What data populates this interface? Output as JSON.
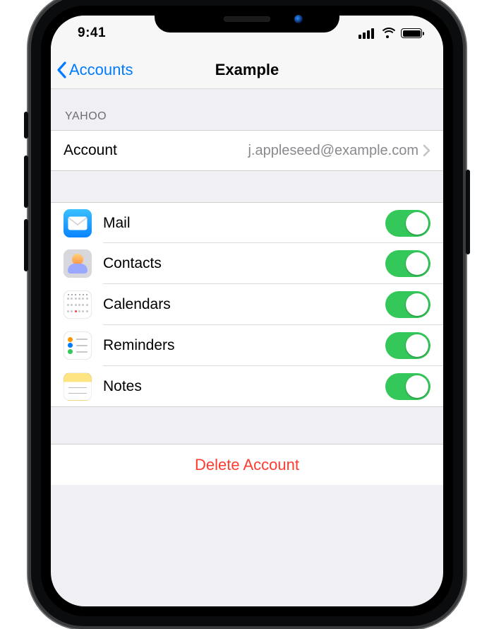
{
  "status": {
    "time": "9:41"
  },
  "nav": {
    "back_label": "Accounts",
    "title": "Example"
  },
  "section_header": "YAHOO",
  "account_row": {
    "label": "Account",
    "value": "j.appleseed@example.com"
  },
  "toggles": [
    {
      "id": "mail",
      "label": "Mail",
      "on": true
    },
    {
      "id": "contacts",
      "label": "Contacts",
      "on": true
    },
    {
      "id": "calendars",
      "label": "Calendars",
      "on": true
    },
    {
      "id": "reminders",
      "label": "Reminders",
      "on": true
    },
    {
      "id": "notes",
      "label": "Notes",
      "on": true
    }
  ],
  "delete_label": "Delete Account",
  "colors": {
    "tint": "#007aff",
    "destructive": "#ff3b30",
    "toggle_on": "#34c759"
  }
}
